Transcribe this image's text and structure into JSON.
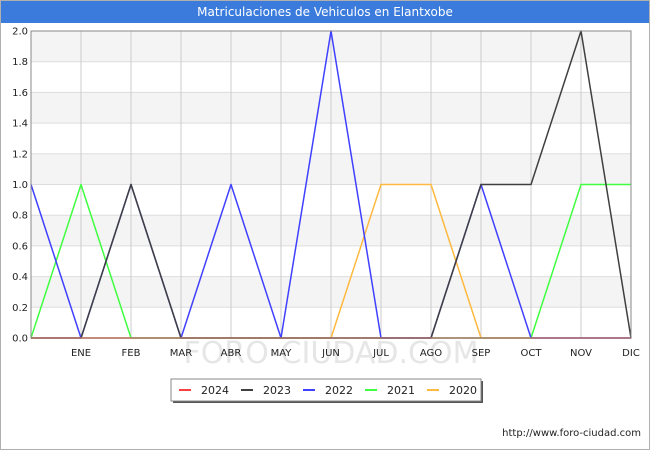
{
  "title": "Matriculaciones de Vehiculos en Elantxobe",
  "source_url": "http://www.foro-ciudad.com",
  "watermark": "FORO-CIUDAD.COM",
  "chart_data": {
    "type": "line",
    "categories": [
      "",
      "ENE",
      "FEB",
      "MAR",
      "ABR",
      "MAY",
      "JUN",
      "JUL",
      "AGO",
      "SEP",
      "OCT",
      "NOV",
      "DIC"
    ],
    "ylim": [
      0,
      2.0
    ],
    "yticks": [
      "0.0",
      "0.2",
      "0.4",
      "0.6",
      "0.8",
      "1.0",
      "1.2",
      "1.4",
      "1.6",
      "1.8",
      "2.0"
    ],
    "grid": true,
    "legend_position": "bottom",
    "series": [
      {
        "name": "2024",
        "color": "#ff4040",
        "values": [
          0,
          0,
          0,
          0,
          0,
          0,
          0,
          0,
          0,
          0,
          0,
          0,
          0
        ]
      },
      {
        "name": "2023",
        "color": "#404040",
        "values": [
          0,
          0,
          1,
          0,
          0,
          0,
          0,
          0,
          0,
          1,
          1,
          2,
          0
        ]
      },
      {
        "name": "2022",
        "color": "#4040ff",
        "values": [
          1,
          0,
          1,
          0,
          1,
          0,
          2,
          0,
          0,
          1,
          0,
          0,
          0
        ]
      },
      {
        "name": "2021",
        "color": "#40ff40",
        "values": [
          0,
          1,
          0,
          0,
          0,
          0,
          0,
          0,
          0,
          0,
          0,
          1,
          1
        ]
      },
      {
        "name": "2020",
        "color": "#ffb940",
        "values": [
          0,
          0,
          0,
          0,
          0,
          0,
          0,
          1,
          1,
          0,
          0,
          0,
          0
        ]
      }
    ]
  }
}
